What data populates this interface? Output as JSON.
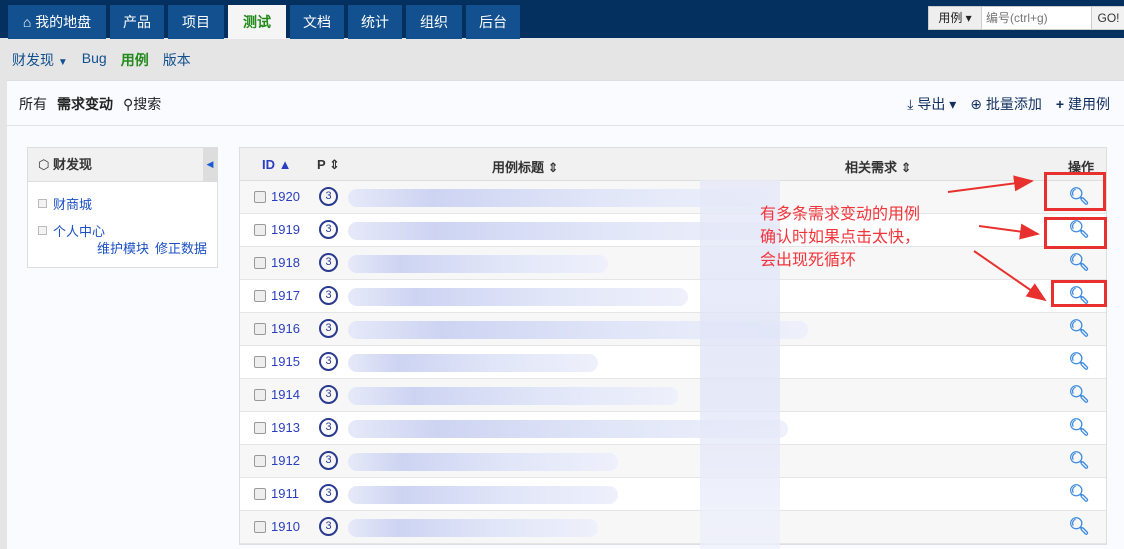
{
  "topnav": {
    "tabs": [
      {
        "label": "我的地盘",
        "icon": "home-icon"
      },
      {
        "label": "产品"
      },
      {
        "label": "项目"
      },
      {
        "label": "测试",
        "active": true
      },
      {
        "label": "文档"
      },
      {
        "label": "统计"
      },
      {
        "label": "组织"
      },
      {
        "label": "后台"
      }
    ],
    "quick": {
      "type": "用例",
      "placeholder": "编号(ctrl+g)",
      "go": "GO!"
    }
  },
  "subnav": {
    "product": "财发现",
    "items": [
      "Bug",
      "用例",
      "版本"
    ]
  },
  "featurebar": {
    "all": "所有",
    "story_change": "需求变动",
    "search": "搜索",
    "export": "导出",
    "batch_add": "批量添加",
    "create": "建用例"
  },
  "sidebar": {
    "title": "财发现",
    "modules": [
      "财商城",
      "个人中心"
    ],
    "maintain": "维护模块",
    "fix": "修正数据"
  },
  "table": {
    "headers": {
      "id": "ID",
      "pri": "P",
      "title": "用例标题",
      "story": "相关需求",
      "actions": "操作"
    },
    "rows": [
      {
        "id": "1920",
        "pri": "3"
      },
      {
        "id": "1919",
        "pri": "3"
      },
      {
        "id": "1918",
        "pri": "3"
      },
      {
        "id": "1917",
        "pri": "3"
      },
      {
        "id": "1916",
        "pri": "3"
      },
      {
        "id": "1915",
        "pri": "3"
      },
      {
        "id": "1914",
        "pri": "3"
      },
      {
        "id": "1913",
        "pri": "3"
      },
      {
        "id": "1912",
        "pri": "3"
      },
      {
        "id": "1911",
        "pri": "3"
      },
      {
        "id": "1910",
        "pri": "3"
      }
    ]
  },
  "annotation": {
    "lines": [
      "有多条需求变动的用例",
      "确认时如果点击太快，",
      "会出现死循环"
    ],
    "color": "#f2343a"
  }
}
